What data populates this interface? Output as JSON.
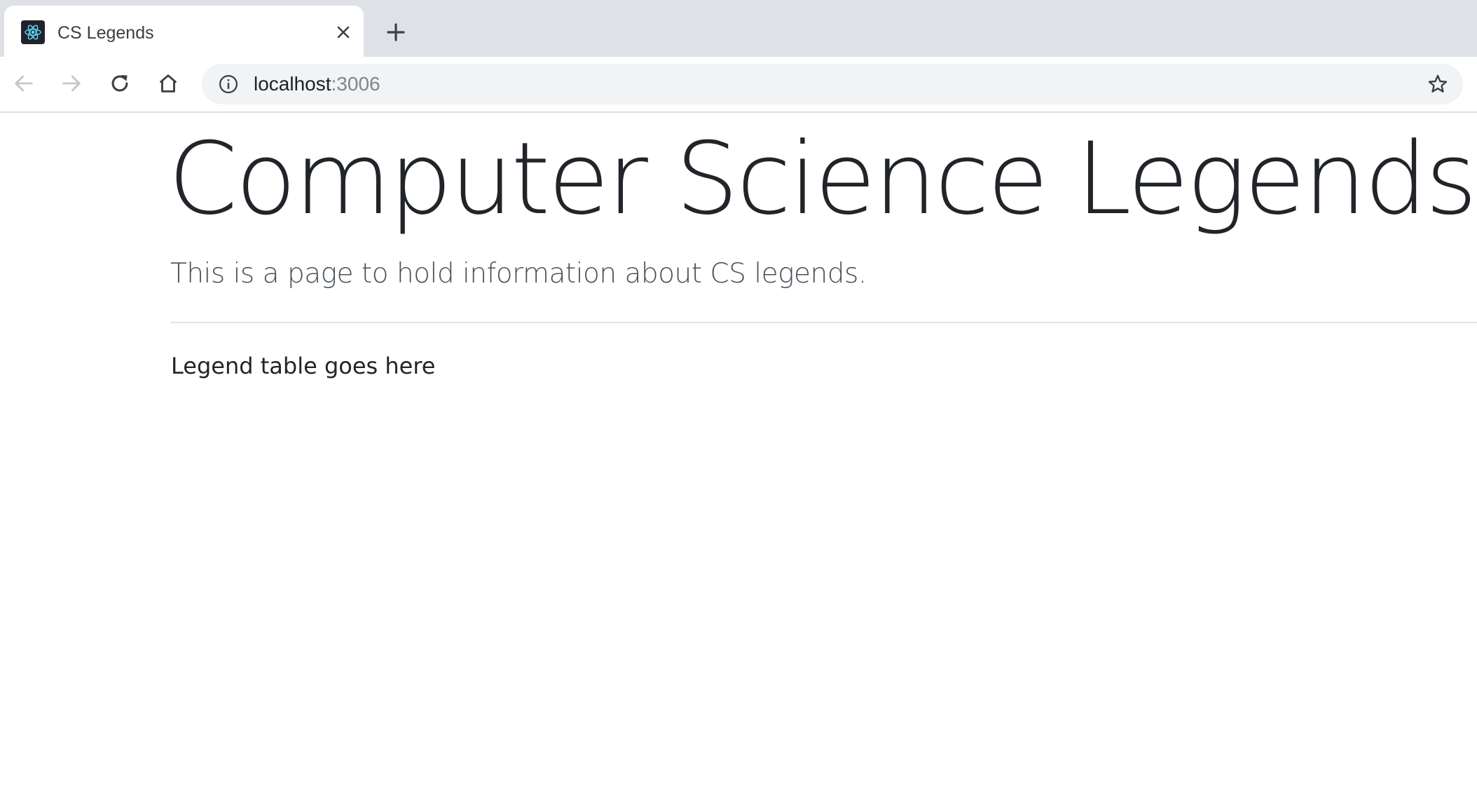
{
  "browser": {
    "tab": {
      "title": "CS Legends",
      "favicon": "react-logo-icon"
    },
    "toolbar": {
      "back": "back-arrow-icon",
      "forward": "forward-arrow-icon",
      "reload": "reload-icon",
      "home": "home-icon"
    },
    "omnibox": {
      "info_icon": "info-icon",
      "url_host": "localhost",
      "url_port": ":3006",
      "bookmark": "star-icon"
    }
  },
  "page": {
    "title": "Computer Science Legends",
    "lead": "This is a page to hold information about CS legends.",
    "placeholder": "Legend table goes here"
  },
  "colors": {
    "tab_strip": "#dee1e6",
    "omnibox": "#f1f3f4",
    "favicon_bg": "#20232a",
    "react_blue": "#61dafb",
    "text": "#212529"
  }
}
